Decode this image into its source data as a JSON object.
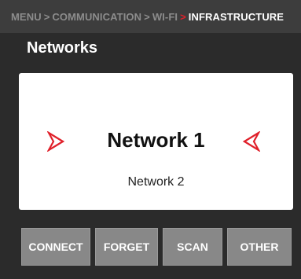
{
  "breadcrumb": {
    "items": [
      "MENU",
      "COMMUNICATION",
      "WI-FI",
      "INFRASTRUCTURE"
    ],
    "separator": ">",
    "accent_color": "#e0202a"
  },
  "page_title": "Networks",
  "networks": {
    "selected": "Network 1",
    "next": "Network 2",
    "prev_arrow_icon": "chevron-right-icon",
    "next_arrow_icon": "chevron-left-icon"
  },
  "buttons": {
    "connect": "CONNECT",
    "forget": "FORGET",
    "scan": "SCAN",
    "other": "OTHER"
  }
}
